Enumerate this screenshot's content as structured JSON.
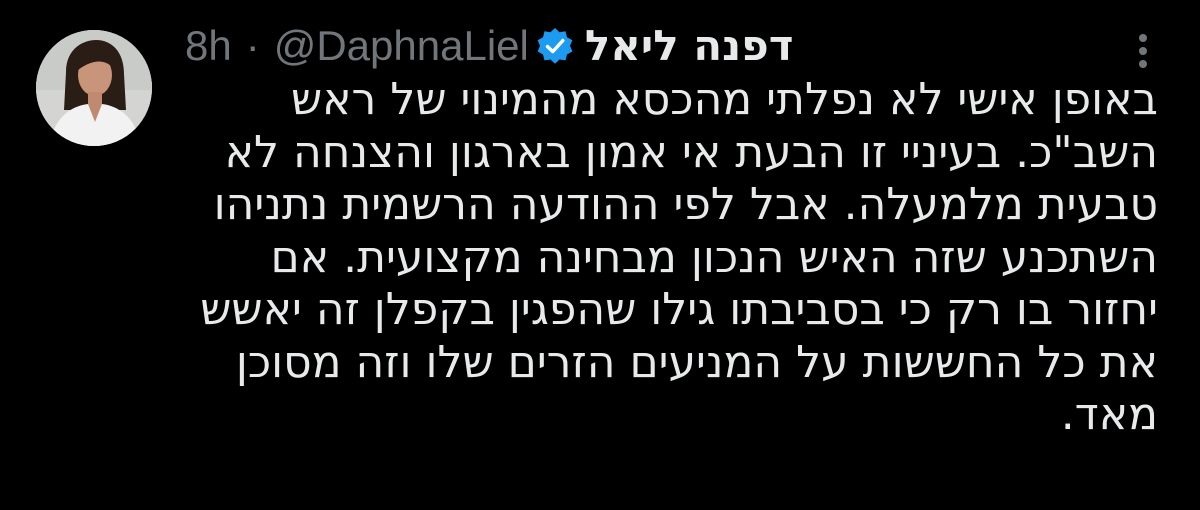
{
  "tweet": {
    "author_name": "דפנה ליאל",
    "handle": "@DaphnaLiel",
    "separator": "·",
    "time": "8h",
    "verified_icon": "verified-badge-icon",
    "more_icon": "more-options-icon",
    "text_lines": [
      "באופן אישי לא נפלתי מהכסא מהמינוי של ראש",
      "השב\"כ. בעיניי זו הבעת אי אמון בארגון והצנחה לא",
      "טבעית מלמעלה. אבל לפי ההודעה הרשמית נתניהו",
      "השתכנע שזה האיש הנכון מבחינה מקצועית. אם",
      "יחזור בו רק כי בסביבתו גילו שהפגין בקפלן זה יאשש",
      "את כל החששות על המניעים הזרים שלו וזה מסוכן",
      "מאד."
    ]
  },
  "colors": {
    "background": "#000000",
    "primary_text": "#e7e9ea",
    "secondary_text": "#71767b",
    "verified_blue": "#1d9bf0"
  }
}
